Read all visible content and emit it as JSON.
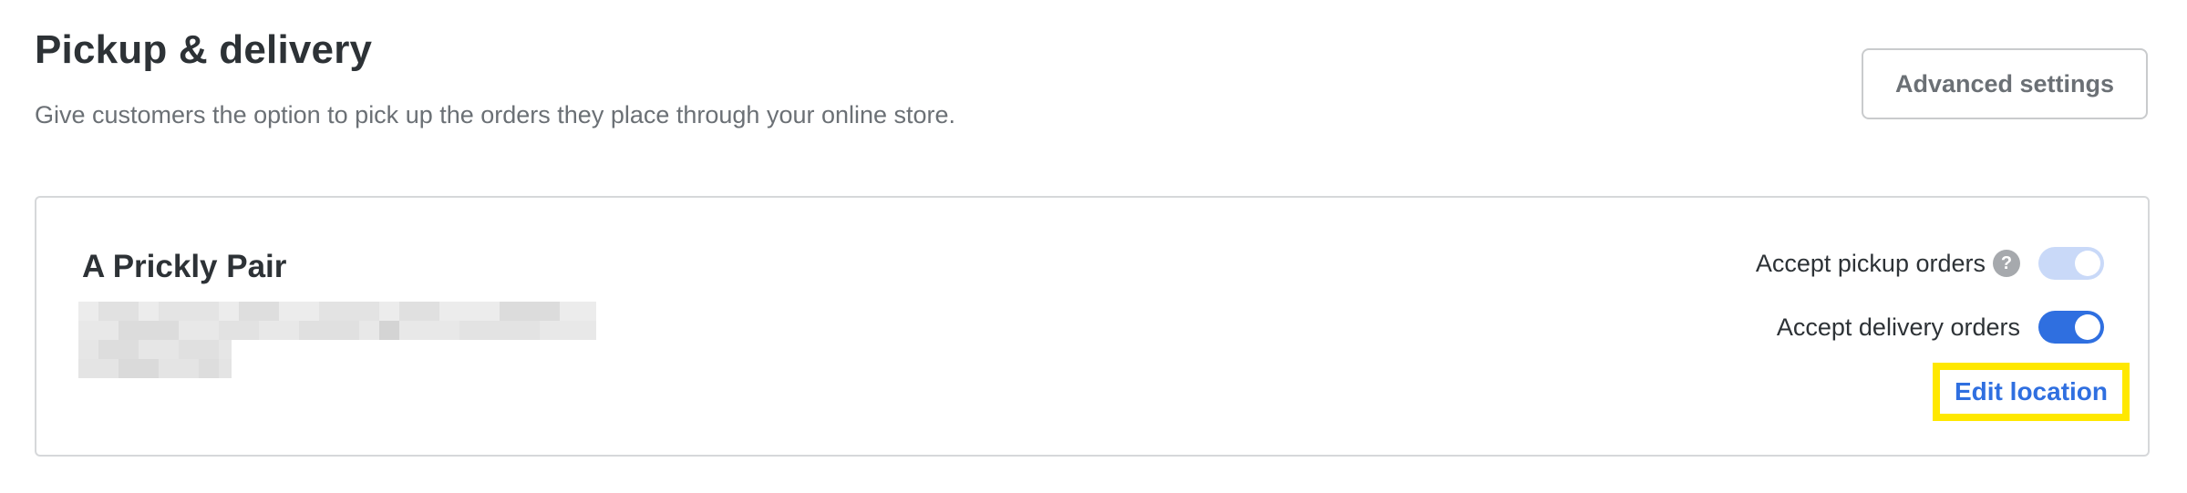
{
  "header": {
    "title": "Pickup & delivery",
    "description": "Give customers the option to pick up the orders they place through your online store.",
    "advanced_settings_label": "Advanced settings"
  },
  "location": {
    "name": "A Prickly Pair",
    "address": "",
    "pickup": {
      "label": "Accept pickup orders",
      "help_icon": "question-circle-icon",
      "enabled": true,
      "disabled": true
    },
    "delivery": {
      "label": "Accept delivery orders",
      "enabled": true
    },
    "edit_label": "Edit location"
  },
  "colors": {
    "accent": "#2f6fe0",
    "highlight": "#ffe800",
    "toggle_disabled": "#c9d9f8",
    "text_primary": "#2d3236",
    "text_secondary": "#6b7075"
  }
}
